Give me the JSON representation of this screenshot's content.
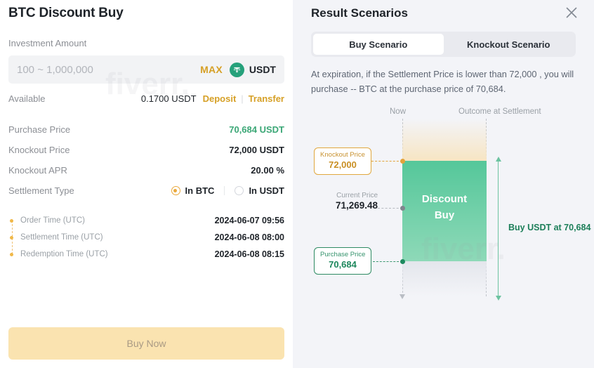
{
  "left": {
    "title": "BTC Discount Buy",
    "investment_label": "Investment Amount",
    "amount_placeholder": "100 ~ 1,000,000",
    "amount_value": "",
    "max_label": "MAX",
    "currency_icon": "tether-icon",
    "currency_label": "USDT",
    "available_label": "Available",
    "available_value": "0.1700 USDT",
    "deposit_link": "Deposit",
    "transfer_link": "Transfer",
    "info_rows": [
      {
        "key": "Purchase Price",
        "value": "70,684 USDT",
        "style": "green"
      },
      {
        "key": "Knockout Price",
        "value": "72,000 USDT",
        "style": "dark"
      },
      {
        "key": "Knockout APR",
        "value": "20.00 %",
        "style": "dark"
      }
    ],
    "settlement_type_label": "Settlement Type",
    "settlement_options": [
      {
        "label": "In BTC",
        "selected": true
      },
      {
        "label": "In USDT",
        "selected": false
      }
    ],
    "timeline": [
      {
        "key": "Order Time (UTC)",
        "value": "2024-06-07 09:56"
      },
      {
        "key": "Settlement Time (UTC)",
        "value": "2024-06-08 08:00"
      },
      {
        "key": "Redemption Time (UTC)",
        "value": "2024-06-08 08:15"
      }
    ],
    "buy_now_label": "Buy Now"
  },
  "right": {
    "title": "Result Scenarios",
    "close_icon": "close-icon",
    "tabs": [
      {
        "label": "Buy Scenario",
        "active": true
      },
      {
        "label": "Knockout Scenario",
        "active": false
      }
    ],
    "scenario_text": "At expiration, if the Settlement Price is lower than 72,000 , you will purchase -- BTC at the purchase price of 70,684."
  },
  "chart_data": {
    "type": "diagram",
    "title": "Buy Scenario payoff diagram",
    "axis_labels": {
      "left": "Now",
      "right": "Outcome at Settlement"
    },
    "bands": [
      {
        "name": "above-knockout",
        "color": "#f7e5c3",
        "from": "72,000",
        "to": "top"
      },
      {
        "name": "discount-buy-zone",
        "color": "#55c79a",
        "label": "Discount\nBuy",
        "from": "70,684",
        "to": "72,000"
      },
      {
        "name": "below-purchase",
        "color": "#e4e6ec",
        "from": "bottom",
        "to": "70,684"
      }
    ],
    "markers": [
      {
        "name": "Knockout Price",
        "value": "72,000",
        "color": "#c98f23"
      },
      {
        "name": "Current Price",
        "value": "71,269.48",
        "color": "#1e2329"
      },
      {
        "name": "Purchase Price",
        "value": "70,684",
        "color": "#1d875c"
      }
    ],
    "band_label_line1": "Discount",
    "band_label_line2": "Buy",
    "outcome_annotation": "Buy USDT at 70,684"
  },
  "watermark": {
    "text1": "fiverr.",
    "text2": "fiverr."
  }
}
